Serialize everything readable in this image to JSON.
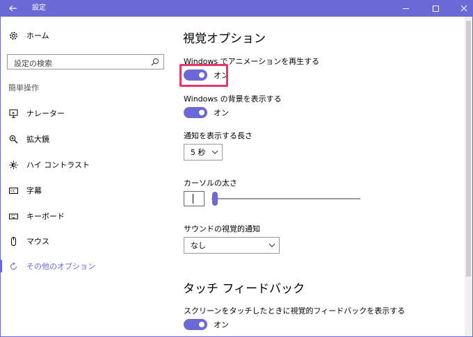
{
  "window": {
    "title": "設定",
    "accent_color": "#6b69d6",
    "highlight_color": "#e8336b"
  },
  "sidebar": {
    "home_label": "ホーム",
    "search_placeholder": "設定の検索",
    "section_label": "簡単操作",
    "items": [
      {
        "label": "ナレーター",
        "icon": "narrator-icon"
      },
      {
        "label": "拡大鏡",
        "icon": "magnifier-icon"
      },
      {
        "label": "ハイ コントラスト",
        "icon": "high-contrast-icon"
      },
      {
        "label": "字幕",
        "icon": "captions-icon"
      },
      {
        "label": "キーボード",
        "icon": "keyboard-icon"
      },
      {
        "label": "マウス",
        "icon": "mouse-icon"
      },
      {
        "label": "その他のオプション",
        "icon": "other-options-icon",
        "selected": true
      }
    ]
  },
  "main": {
    "visual_heading": "視覚オプション",
    "animation_label": "Windows でアニメーションを再生する",
    "animation_toggle": "オン",
    "animation_on": true,
    "background_label": "Windows の背景を表示する",
    "background_toggle": "オン",
    "background_on": true,
    "notify_label": "通知を表示する長さ",
    "notify_value": "5 秒",
    "cursor_label": "カーソルの太さ",
    "cursor_value": 1,
    "sound_label": "サウンドの視覚的通知",
    "sound_value": "なし",
    "touch_heading": "タッチ フィードバック",
    "touch_label": "スクリーンをタッチしたときに視覚的フィードバックを表示する",
    "touch_toggle": "オン",
    "touch_on": true
  }
}
